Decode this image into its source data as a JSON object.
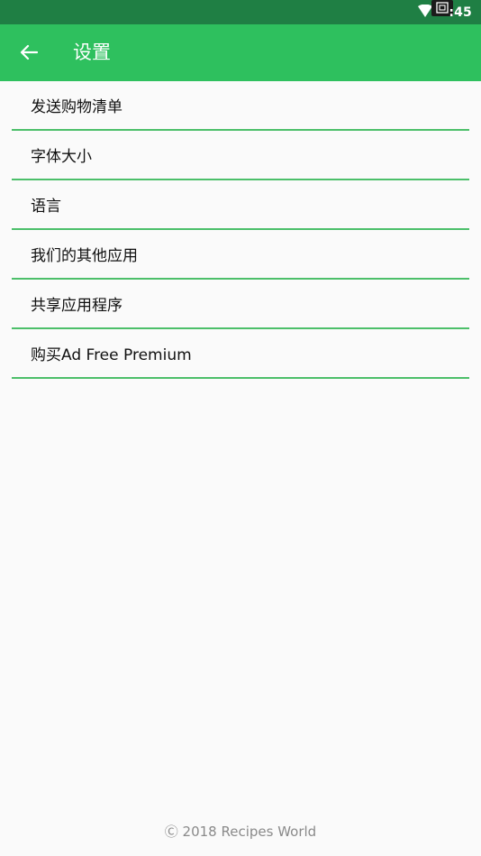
{
  "status_bar": {
    "time": ":45",
    "icons": [
      "wifi-icon",
      "screenshot-icon"
    ]
  },
  "app_bar": {
    "back_icon": "arrow-left-icon",
    "title": "设置"
  },
  "menu": {
    "items": [
      {
        "label": "发送购物清单"
      },
      {
        "label": "字体大小"
      },
      {
        "label": "语言"
      },
      {
        "label": "我们的其他应用"
      },
      {
        "label": "共享应用程序"
      },
      {
        "label": "购买Ad Free Premium"
      }
    ]
  },
  "footer": {
    "copyright": "Ⓒ 2018 Recipes World"
  },
  "colors": {
    "status_bar": "#1f7f44",
    "app_bar": "#2ec05e",
    "divider": "#4cbf6a",
    "background": "#fafafa",
    "footer_text": "#8a8a8a"
  }
}
